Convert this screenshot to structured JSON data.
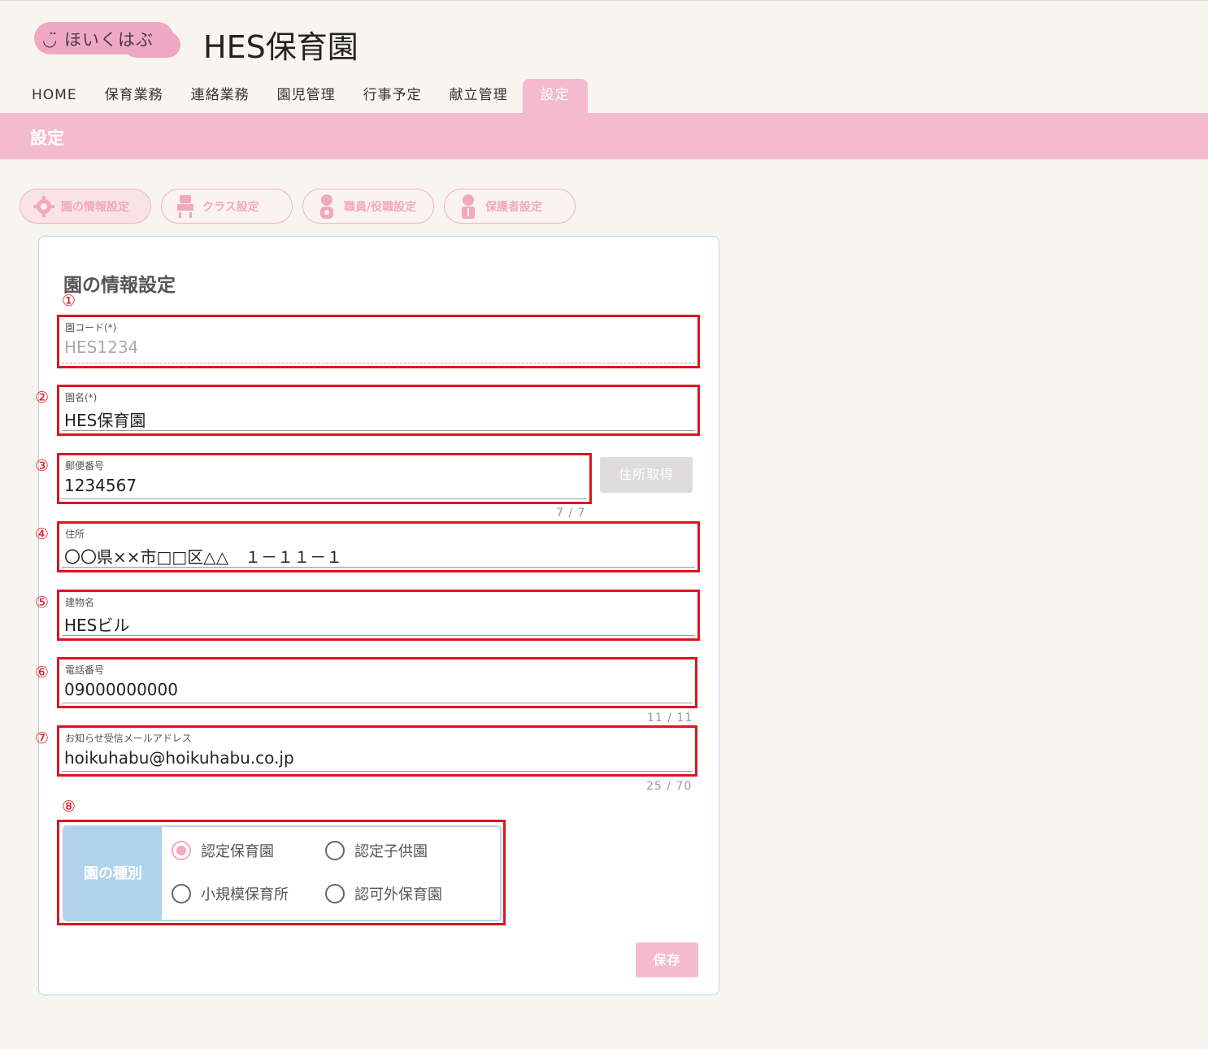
{
  "header": {
    "logo_text": "ほいくはぶ",
    "app_title": "HES保育園"
  },
  "nav": {
    "items": [
      {
        "label": "HOME"
      },
      {
        "label": "保育業務"
      },
      {
        "label": "連絡業務"
      },
      {
        "label": "園児管理"
      },
      {
        "label": "行事予定"
      },
      {
        "label": "献立管理"
      },
      {
        "label": "設定",
        "active": true
      }
    ]
  },
  "page": {
    "title": "設定"
  },
  "subtabs": [
    {
      "label": "園の情報設定",
      "icon": "gear-icon",
      "active": true
    },
    {
      "label": "クラス設定",
      "icon": "class-icon"
    },
    {
      "label": "職員/役職設定",
      "icon": "staff-icon"
    },
    {
      "label": "保護者設定",
      "icon": "guardian-icon"
    }
  ],
  "card": {
    "title": "園の情報設定"
  },
  "annotations": [
    "①",
    "②",
    "③",
    "④",
    "⑤",
    "⑥",
    "⑦",
    "⑧"
  ],
  "fields": {
    "code": {
      "label": "園コード(*)",
      "value": "HES1234"
    },
    "name": {
      "label": "園名(*)",
      "value": "HES保育園"
    },
    "postal": {
      "label": "郵便番号",
      "value": "1234567",
      "counter": "7 / 7"
    },
    "address": {
      "label": "住所",
      "value": "〇〇県××市□□区△△　１－１１－１"
    },
    "building": {
      "label": "建物名",
      "value": "HESビル"
    },
    "phone": {
      "label": "電話番号",
      "value": "09000000000",
      "counter": "11 / 11"
    },
    "email": {
      "label": "お知らせ受信メールアドレス",
      "value": "hoikuhabu@hoikuhabu.co.jp",
      "counter": "25 / 70"
    }
  },
  "buttons": {
    "get_address": "住所取得",
    "save": "保存"
  },
  "facility_type": {
    "label": "園の種別",
    "options": [
      {
        "label": "認定保育園",
        "checked": true
      },
      {
        "label": "認定子供園",
        "checked": false
      },
      {
        "label": "小規模保育所",
        "checked": false
      },
      {
        "label": "認可外保育園",
        "checked": false
      }
    ]
  },
  "colors": {
    "accent_pink": "#f4bace",
    "annotation_red": "#e0141f",
    "type_label_blue": "#b0d3ec"
  }
}
